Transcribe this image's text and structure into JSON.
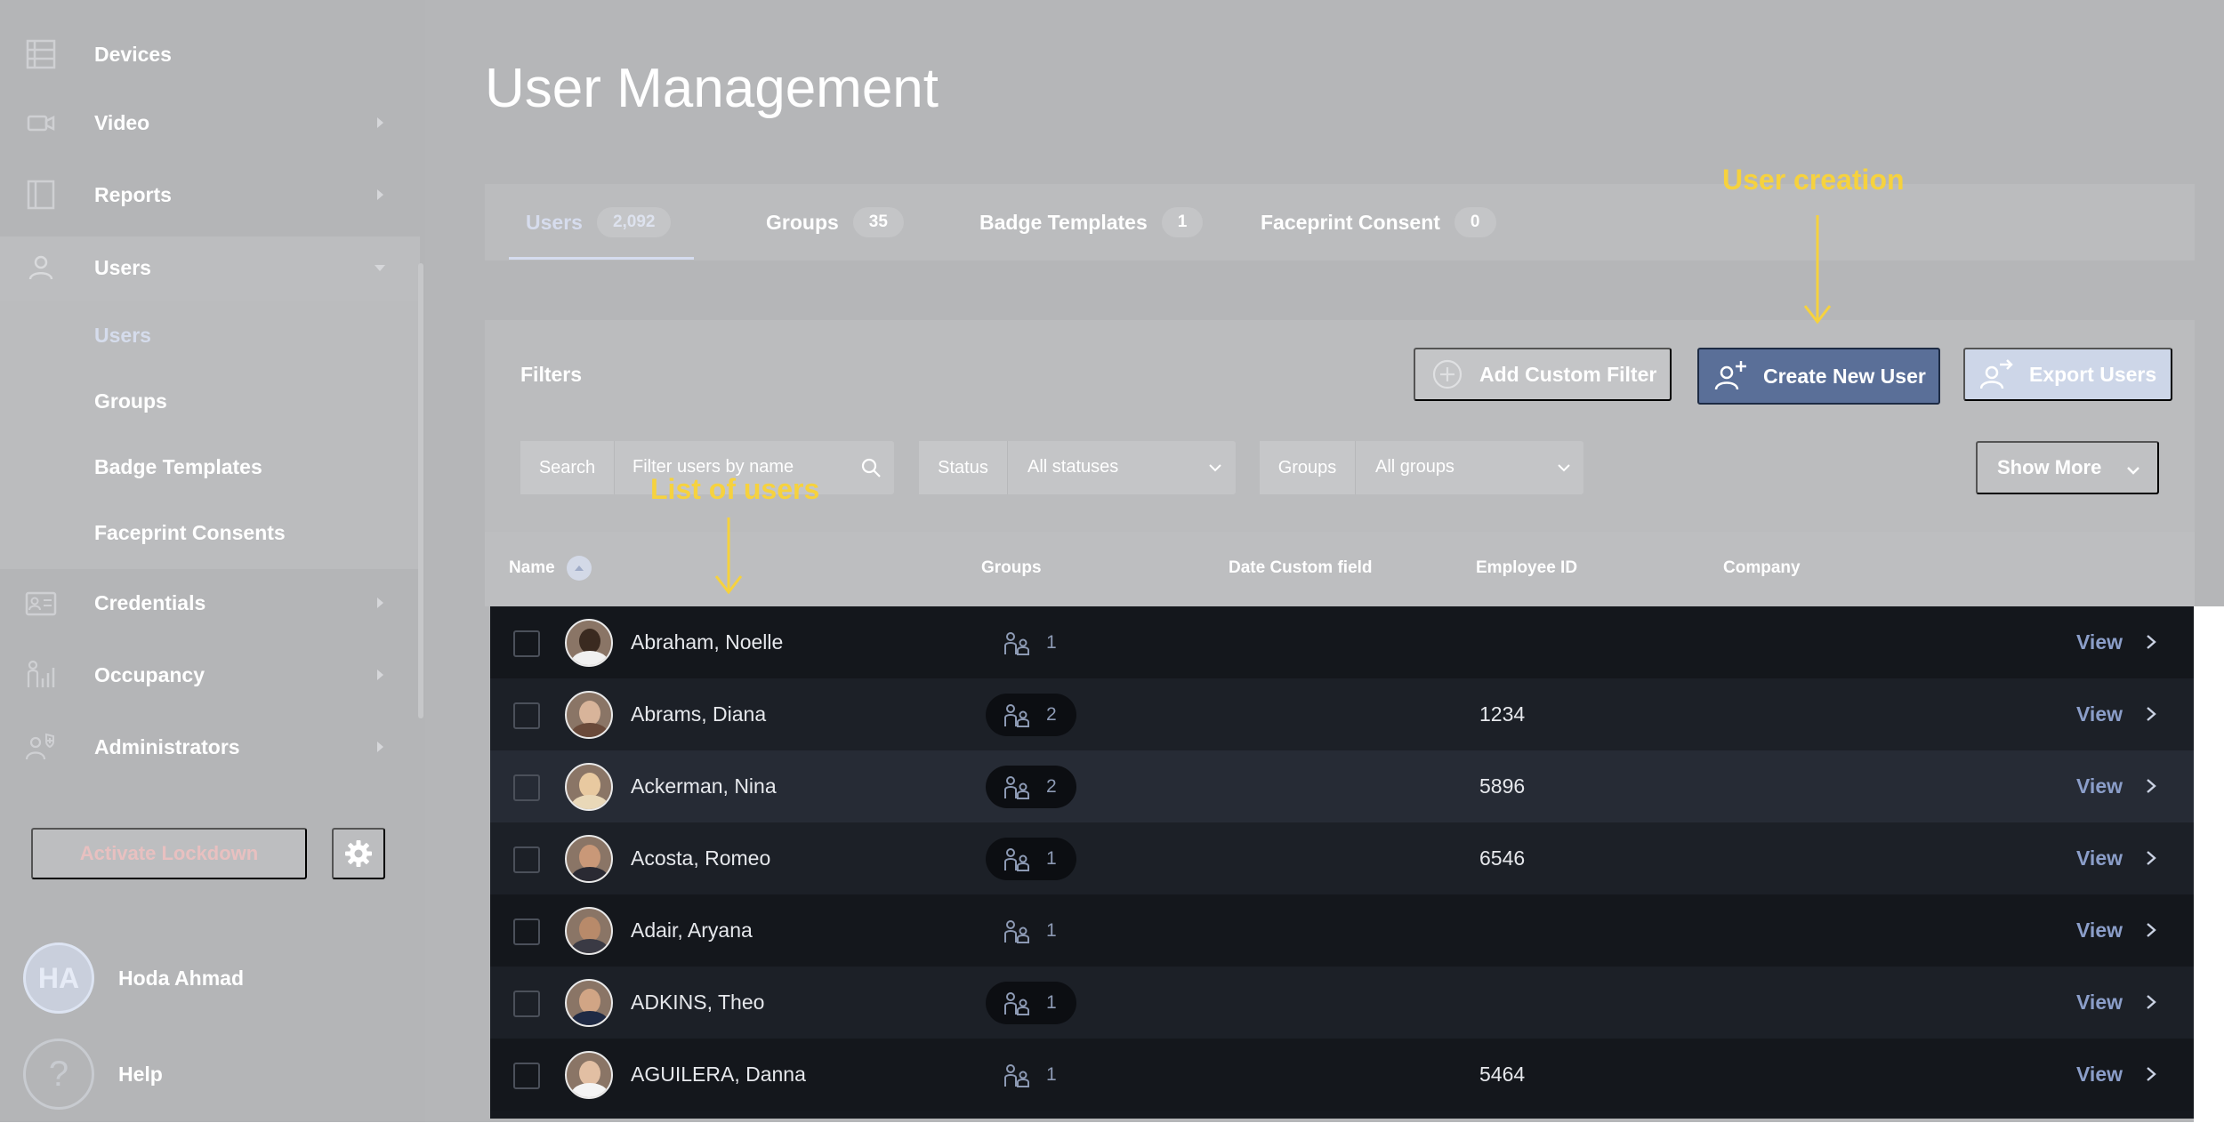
{
  "sidebar": {
    "items": [
      {
        "label": "Devices",
        "icon": "devices-icon"
      },
      {
        "label": "Video",
        "icon": "video-camera-icon"
      },
      {
        "label": "Reports",
        "icon": "reports-icon"
      },
      {
        "label": "Users",
        "icon": "user-icon"
      },
      {
        "label": "Credentials",
        "icon": "credentials-icon"
      },
      {
        "label": "Occupancy",
        "icon": "occupancy-icon"
      },
      {
        "label": "Administrators",
        "icon": "administrators-icon"
      }
    ],
    "users_sub": [
      {
        "label": "Users",
        "active": true
      },
      {
        "label": "Groups"
      },
      {
        "label": "Badge Templates"
      },
      {
        "label": "Faceprint Consents"
      }
    ],
    "lockdown_label": "Activate Lockdown",
    "user": {
      "initials": "HA",
      "name": "Hoda Ahmad"
    },
    "help_label": "Help"
  },
  "page_title": "User Management",
  "tabs": [
    {
      "label": "Users",
      "count": "2,092",
      "active": true
    },
    {
      "label": "Groups",
      "count": "35"
    },
    {
      "label": "Badge Templates",
      "count": "1"
    },
    {
      "label": "Faceprint Consent",
      "count": "0"
    }
  ],
  "filters": {
    "title": "Filters",
    "add_custom_filter": "Add Custom Filter",
    "create_new_user": "Create New User",
    "export_users": "Export Users",
    "search_label": "Search",
    "search_placeholder": "Filter users by name",
    "status_label": "Status",
    "status_value": "All statuses",
    "groups_label": "Groups",
    "groups_value": "All groups",
    "show_more": "Show More"
  },
  "table": {
    "columns": [
      "Name",
      "Groups",
      "Date Custom field",
      "Employee ID",
      "Company"
    ],
    "view_label": "View",
    "rows": [
      {
        "name": "Abraham, Noelle",
        "groups": "1",
        "employee_id": ""
      },
      {
        "name": "Abrams, Diana",
        "groups": "2",
        "employee_id": "1234"
      },
      {
        "name": "Ackerman, Nina",
        "groups": "2",
        "employee_id": "5896"
      },
      {
        "name": "Acosta, Romeo",
        "groups": "1",
        "employee_id": "6546"
      },
      {
        "name": "Adair, Aryana",
        "groups": "1",
        "employee_id": ""
      },
      {
        "name": "ADKINS, Theo",
        "groups": "1",
        "employee_id": ""
      },
      {
        "name": "AGUILERA, Danna",
        "groups": "1",
        "employee_id": "5464"
      }
    ]
  },
  "annotations": {
    "user_creation": "User creation",
    "list_of_users": "List of users"
  },
  "colors": {
    "accent": "#5a6f98",
    "annotation": "#f6d23e",
    "table_bg": "#15181e",
    "view_link": "#8b9ec9"
  }
}
